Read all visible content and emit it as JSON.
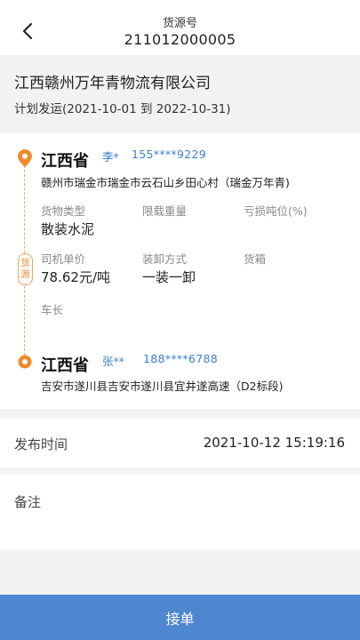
{
  "header": {
    "label": "货源号",
    "value": "211012000005"
  },
  "company": {
    "name": "江西赣州万年青物流有限公司",
    "plan": "计划发运(2021-10-01 到 2022-10-31)"
  },
  "route": {
    "origin": {
      "province": "江西省",
      "contact_name": "李*",
      "contact_phone": "155****9229",
      "address": "赣州市瑞金市瑞金市云石山乡田心村（瑞金万年青)"
    },
    "source_badge": [
      "货",
      "源"
    ],
    "cargo": {
      "type_label": "货物类型",
      "type_value": "散装水泥",
      "weight_label": "限载重量",
      "weight_value": "",
      "loss_label": "亏损吨位(%)",
      "loss_value": "",
      "price_label": "司机单价",
      "price_value": "78.62元/吨",
      "loading_label": "装卸方式",
      "loading_value": "一装一卸",
      "box_label": "货箱",
      "box_value": "",
      "length_label": "车长",
      "length_value": ""
    },
    "destination": {
      "province": "江西省",
      "contact_name": "张**",
      "contact_phone": "188****6788",
      "address": "吉安市遂川县吉安市遂川县宜井遂高速（D2标段)"
    }
  },
  "publish": {
    "label": "发布时间",
    "value": "2021-10-12 15:19:16"
  },
  "remark": {
    "label": "备注",
    "value": ""
  },
  "actions": {
    "accept_label": "接单"
  },
  "colors": {
    "accent_blue": "#4e86cf",
    "link_blue": "#3a7fd1",
    "node_orange": "#f08a2c"
  },
  "icons": [
    "back-arrow-icon",
    "origin-pin-icon",
    "destination-dot-icon"
  ]
}
